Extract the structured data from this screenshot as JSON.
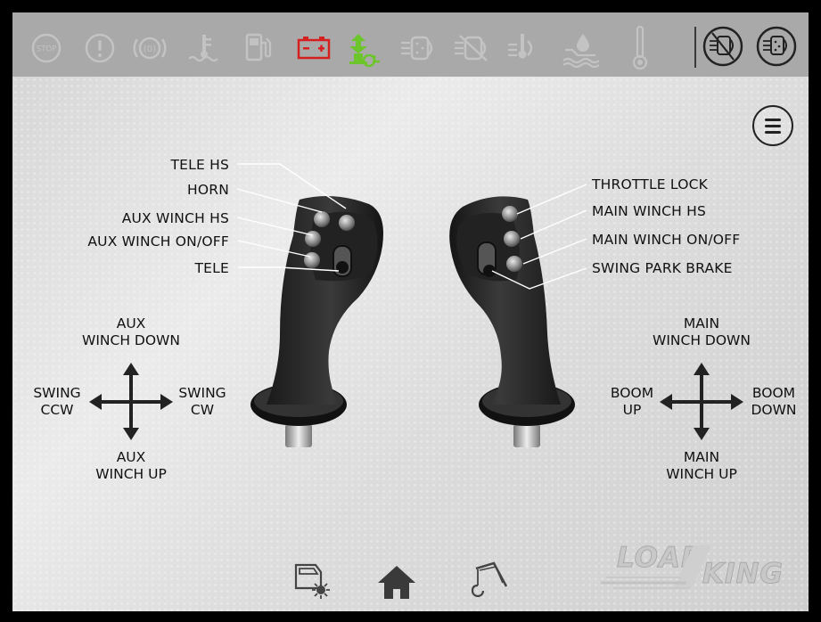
{
  "status_bar": {
    "icons": [
      "stop-icon",
      "warning-icon",
      "brake-icon",
      "coolant-temp-icon",
      "fuel-icon",
      "battery-icon",
      "hydraulic-icon",
      "regen-icon",
      "regen-inhibit-icon",
      "exhaust-temp-icon",
      "water-in-fuel-icon",
      "temperature-gauge-icon",
      "regen-inhibit-button-icon",
      "regen-request-button-icon"
    ],
    "stop_text": "STOP",
    "active_colors": {
      "battery": "#d62020",
      "hydraulic": "#6cc52a",
      "inactive": "#c3c3c3"
    }
  },
  "left_stick": {
    "labels": [
      "TELE HS",
      "HORN",
      "AUX WINCH HS",
      "AUX WINCH ON/OFF",
      "TELE"
    ]
  },
  "right_stick": {
    "labels": [
      "THROTTLE LOCK",
      "MAIN WINCH HS",
      "MAIN WINCH ON/OFF",
      "SWING PARK BRAKE"
    ]
  },
  "left_directions": {
    "up": [
      "AUX",
      "WINCH DOWN"
    ],
    "down": [
      "AUX",
      "WINCH UP"
    ],
    "left": [
      "SWING",
      "CCW"
    ],
    "right": [
      "SWING",
      "CW"
    ]
  },
  "right_directions": {
    "up": [
      "MAIN",
      "WINCH DOWN"
    ],
    "down": [
      "MAIN",
      "WINCH UP"
    ],
    "left": [
      "BOOM",
      "UP"
    ],
    "right": [
      "BOOM",
      "DOWN"
    ]
  },
  "bottom_nav": {
    "items": [
      "cab-lights-icon",
      "home-icon",
      "crane-hook-icon"
    ]
  },
  "logo": {
    "word1": "LOAD",
    "word2": "KING"
  }
}
